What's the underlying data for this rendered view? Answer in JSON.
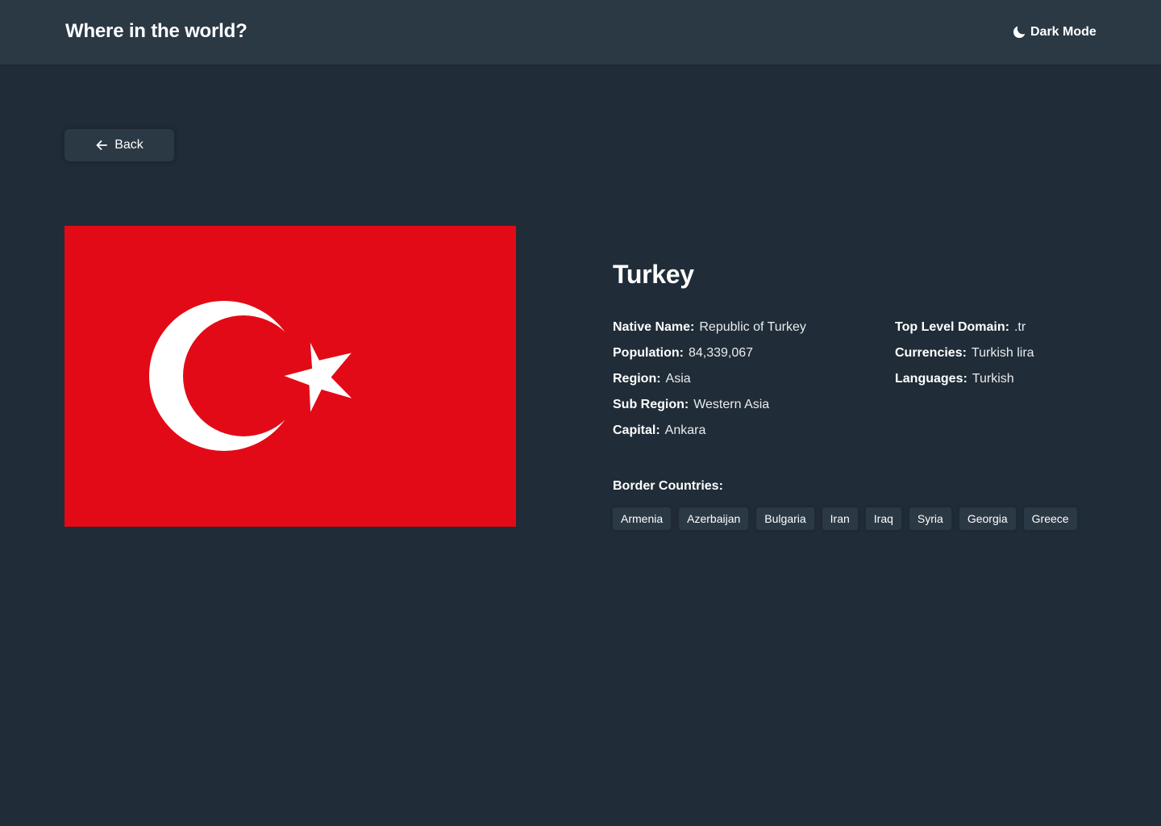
{
  "header": {
    "title": "Where in the world?",
    "mode_toggle": {
      "label": "Dark Mode",
      "icon": "moon-icon"
    }
  },
  "back_button": {
    "label": "Back",
    "icon": "arrow-left-icon"
  },
  "country": {
    "name": "Turkey",
    "flag": {
      "description_icon": "turkey-flag",
      "background_color": "#e30a17",
      "emblem_color": "#ffffff"
    },
    "details_left": [
      {
        "key": "Native Name:",
        "value": "Republic of Turkey"
      },
      {
        "key": "Population:",
        "value": "84,339,067"
      },
      {
        "key": "Region:",
        "value": "Asia"
      },
      {
        "key": "Sub Region:",
        "value": "Western Asia"
      },
      {
        "key": "Capital:",
        "value": "Ankara"
      }
    ],
    "details_right": [
      {
        "key": "Top Level Domain:",
        "value": ".tr"
      },
      {
        "key": "Currencies:",
        "value": "Turkish lira"
      },
      {
        "key": "Languages:",
        "value": "Turkish"
      }
    ],
    "border_label": "Border Countries:",
    "borders": [
      "Armenia",
      "Azerbaijan",
      "Bulgaria",
      "Iran",
      "Iraq",
      "Syria",
      "Georgia",
      "Greece"
    ]
  },
  "colors": {
    "background": "#202c37",
    "elements": "#2b3945",
    "text": "#ffffff"
  }
}
